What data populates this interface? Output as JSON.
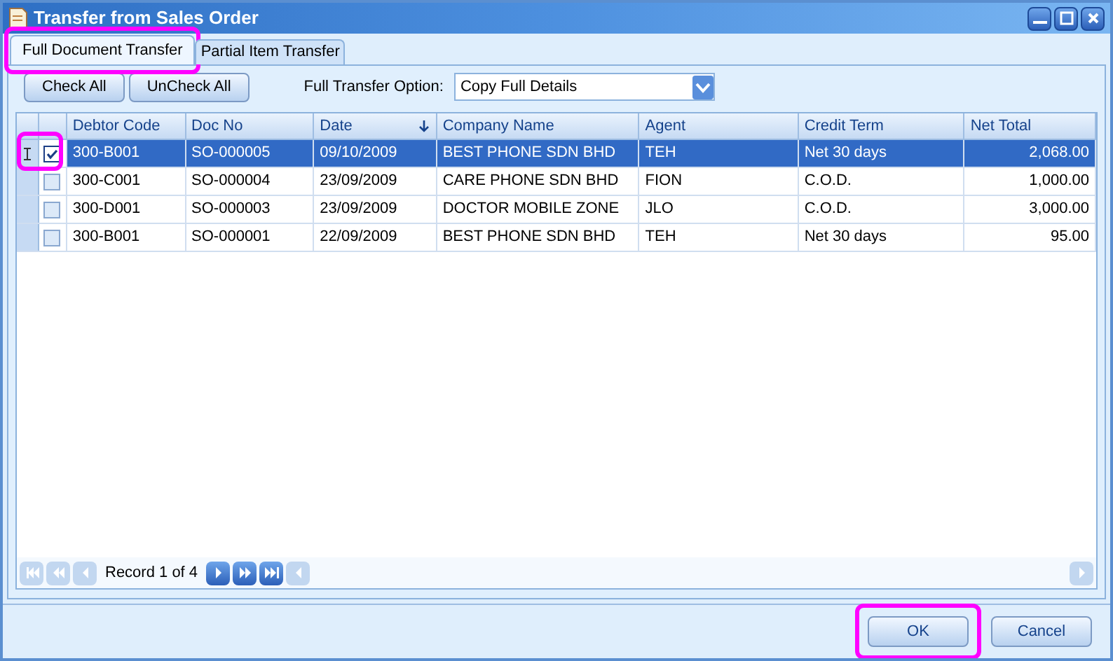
{
  "window": {
    "title": "Transfer from Sales Order"
  },
  "tabs": [
    {
      "label": "Full Document Transfer",
      "selected": true,
      "highlighted": true
    },
    {
      "label": "Partial Item Transfer",
      "selected": false,
      "highlighted": false
    }
  ],
  "toolbar": {
    "buttons": [
      "Check All",
      "UnCheck All"
    ],
    "option_label": "Full Transfer Option:",
    "option_value": "Copy Full Details"
  },
  "table": {
    "columns": [
      {
        "label": "Debtor Code",
        "sorted": false
      },
      {
        "label": "Doc No",
        "sorted": false
      },
      {
        "label": "Date",
        "sorted": true
      },
      {
        "label": "Company Name",
        "sorted": false
      },
      {
        "label": "Agent",
        "sorted": false
      },
      {
        "label": "Credit Term",
        "sorted": false
      },
      {
        "label": "Net Total",
        "sorted": false
      }
    ],
    "rows": [
      {
        "selected": true,
        "checked": true,
        "highlighted": true,
        "cells": [
          "300-B001",
          "SO-000005",
          "09/10/2009",
          "BEST PHONE SDN BHD",
          "TEH",
          "Net 30 days",
          "2,068.00"
        ]
      },
      {
        "selected": false,
        "checked": false,
        "highlighted": false,
        "cells": [
          "300-C001",
          "SO-000004",
          "23/09/2009",
          "CARE PHONE SDN BHD",
          "FION",
          "C.O.D.",
          "1,000.00"
        ]
      },
      {
        "selected": false,
        "checked": false,
        "highlighted": false,
        "cells": [
          "300-D001",
          "SO-000003",
          "23/09/2009",
          "DOCTOR MOBILE ZONE",
          "JLO",
          "C.O.D.",
          "3,000.00"
        ]
      },
      {
        "selected": false,
        "checked": false,
        "highlighted": false,
        "cells": [
          "300-B001",
          "SO-000001",
          "22/09/2009",
          "BEST PHONE SDN BHD",
          "TEH",
          "Net 30 days",
          "95.00"
        ]
      }
    ]
  },
  "navigator": {
    "record": "Record 1 of 4",
    "buttons": [
      {
        "kind": "first",
        "disabled": true
      },
      {
        "kind": "prev-page",
        "disabled": true
      },
      {
        "kind": "prev",
        "disabled": true
      },
      {
        "kind": "next",
        "disabled": false
      },
      {
        "kind": "next-page",
        "disabled": false
      },
      {
        "kind": "last",
        "disabled": false
      }
    ]
  },
  "footer": {
    "buttons": [
      {
        "label": "OK",
        "highlighted": true
      },
      {
        "label": "Cancel",
        "highlighted": false
      }
    ]
  }
}
